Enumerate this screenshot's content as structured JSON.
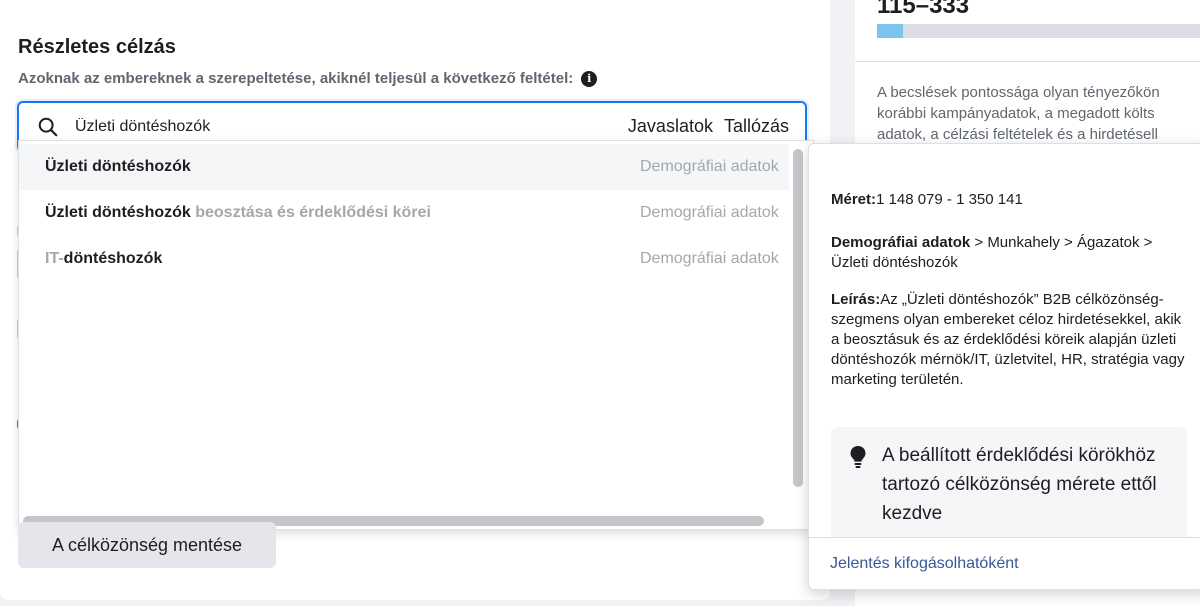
{
  "detailed_targeting": {
    "title": "Részletes célzás",
    "subtitle": "Azoknak az embereknek a szerepeltetése, akiknél teljesül a következő feltétel:",
    "search": {
      "value": "Üzleti döntéshozók",
      "suggestions_label": "Javaslatok",
      "browse_label": "Tallózás"
    },
    "results": [
      {
        "strong": "Üzleti döntéshozók",
        "muted": "",
        "category": "Demográfiai adatok"
      },
      {
        "strong": "Üzleti döntéshozók",
        "muted": " beosztása és érdeklődési körei",
        "category": "Demográfiai adatok"
      },
      {
        "muted": "IT-",
        "strong": "döntéshozók",
        "category": "Demográfiai adatok"
      }
    ],
    "save_label": "A célközönség mentése"
  },
  "estimate": {
    "range_text": "115–333",
    "progress_fraction": 0.08,
    "description": [
      "A becslések pontossága olyan tényezőkön",
      "korábbi kampányadatok, a megadott költs",
      "adatok, a célzási feltételek és a hirdetésell"
    ]
  },
  "popover": {
    "size_label": "Méret:",
    "size_value": "1 148 079 - 1 350 141",
    "path_label": "Demográfiai adatok",
    "path_rest": " > Munkahely > Ágazatok > Üzleti döntéshozók",
    "desc_label": "Leírás:",
    "desc_value": "Az „Üzleti döntéshozók” B2B célközönség-szegmens olyan embereket céloz hirdetésekkel, akik a beosztásuk és az érdeklődési köreik alapján üzleti döntéshozók mérnök/IT, üzletvitel, HR, stratégia vagy marketing területén.",
    "tip_text": "A beállított érdeklődési körökhöz tartozó célközönség mérete ettől kezdve",
    "report_label": "Jelentés kifogásolhatóként"
  },
  "colors": {
    "accent": "#1877f2",
    "progress": "#7cc3ee",
    "link": "#385898"
  }
}
